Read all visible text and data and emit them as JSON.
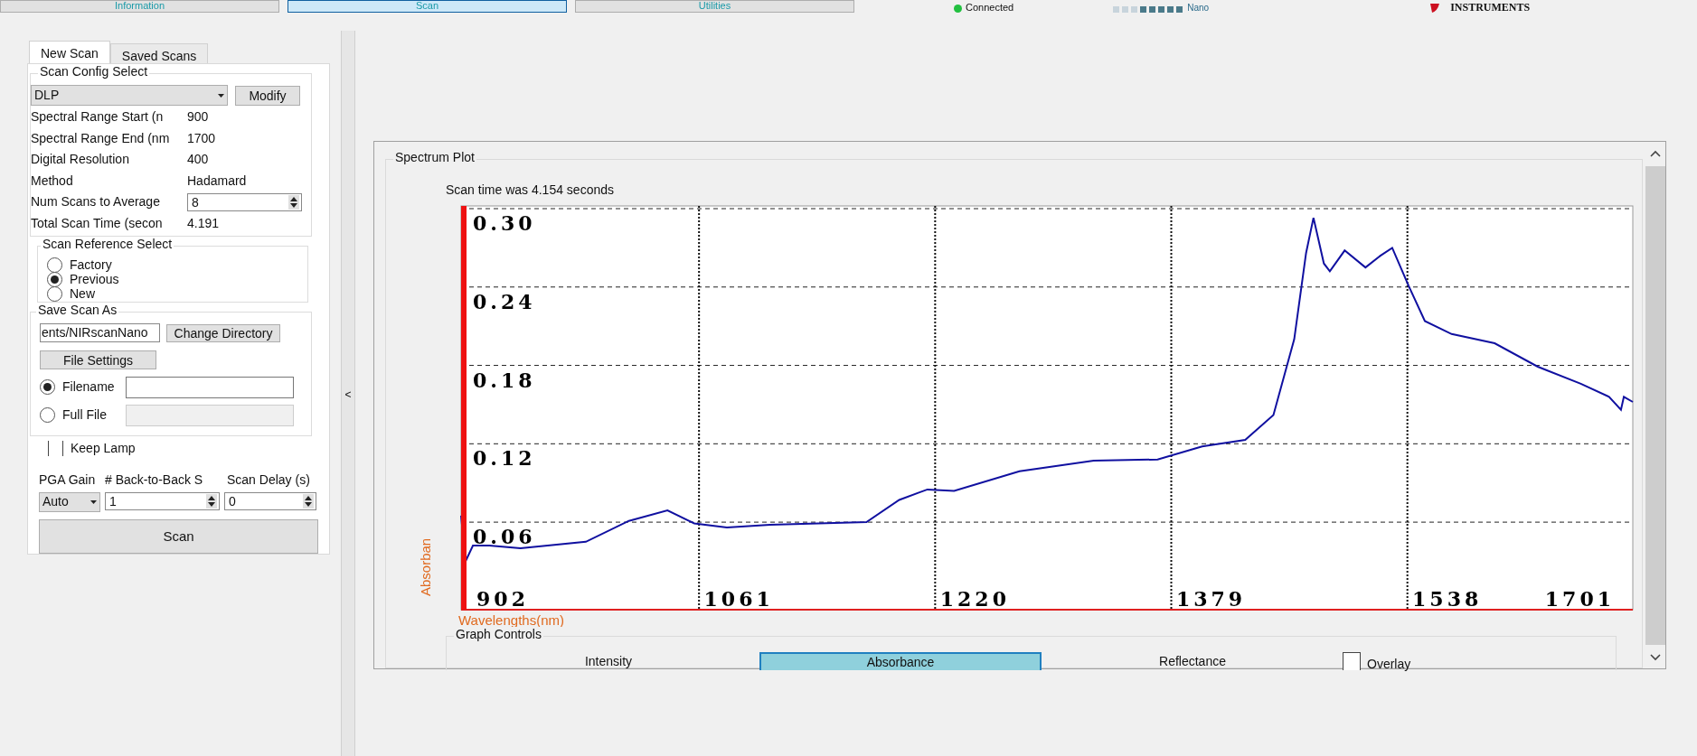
{
  "top_tabs": [
    {
      "label": "Information",
      "selected": false
    },
    {
      "label": "Scan",
      "selected": true
    },
    {
      "label": "Utilities",
      "selected": false
    }
  ],
  "status": {
    "label": "Connected",
    "connected": true
  },
  "logos": {
    "product": "Nano",
    "company": "INSTRUMENTS"
  },
  "left_tabs": [
    {
      "label": "New Scan",
      "selected": true
    },
    {
      "label": "Saved Scans",
      "selected": false
    }
  ],
  "scan_config": {
    "title": "Scan Config Select",
    "config": "DLP",
    "modify": "Modify",
    "fields": [
      {
        "kind": "text",
        "label": "Spectral Range Start (n",
        "value": "900"
      },
      {
        "kind": "text",
        "label": "Spectral Range End (nm",
        "value": "1700"
      },
      {
        "kind": "text",
        "label": "Digital Resolution",
        "value": "400"
      },
      {
        "kind": "text",
        "label": "Method",
        "value": "Hadamard"
      },
      {
        "kind": "spin",
        "label": "Num Scans to Average",
        "value": "8"
      },
      {
        "kind": "text",
        "label": "Total Scan Time (secon",
        "value": "4.191"
      }
    ]
  },
  "reference": {
    "title": "Scan Reference Select",
    "options": [
      {
        "label": "Factory",
        "selected": false
      },
      {
        "label": "Previous",
        "selected": true
      },
      {
        "label": "New",
        "selected": false
      }
    ]
  },
  "save": {
    "title": "Save Scan As",
    "directory": "ents/NIRscanNano",
    "change_directory": "Change Directory",
    "file_settings": "File Settings",
    "options": [
      {
        "label": "Filename",
        "selected": true,
        "enabled": true
      },
      {
        "label": "Full File",
        "selected": false,
        "enabled": false
      }
    ]
  },
  "keep_lamp": {
    "label": "Keep Lamp",
    "checked": false
  },
  "gain": {
    "label": "PGA Gain",
    "value": "Auto"
  },
  "back_to_back": {
    "label": "# Back-to-Back S",
    "value": "1"
  },
  "delay": {
    "label": "Scan Delay (s)",
    "value": "0"
  },
  "scan_button": "Scan",
  "splitter": "<",
  "spectrum": {
    "title": "Spectrum Plot",
    "scan_time": "Scan time was 4.154 seconds",
    "chart_data": {
      "type": "line",
      "xlabel": "Wavelengths(nm)",
      "ylabel": "Absorban",
      "grid": true,
      "xlim": [
        874,
        1663
      ],
      "ylim": [
        -0.007,
        0.3
      ],
      "xticks": [
        902,
        1061,
        1220,
        1379,
        1538
      ],
      "yticks": [
        {
          "value": 0.06,
          "label": "0.06"
        },
        {
          "value": 0.12,
          "label": "0.12"
        },
        {
          "value": 0.18,
          "label": "0.18"
        },
        {
          "value": 0.24,
          "label": "0.24"
        },
        {
          "value": 0.3,
          "label": "0.30"
        }
      ],
      "x": [
        874,
        877,
        882,
        893,
        914,
        958,
        987,
        1013,
        1031,
        1053,
        1082,
        1147,
        1169,
        1188,
        1206,
        1250,
        1300,
        1343,
        1373,
        1402,
        1421,
        1435,
        1443,
        1448,
        1455,
        1459,
        1469,
        1483,
        1493,
        1501,
        1512,
        1523,
        1541,
        1570,
        1599,
        1628,
        1647,
        1655,
        1657,
        1663
      ],
      "series": [
        {
          "color": "#1010a0",
          "values": [
            0.065,
            0.03,
            0.042,
            0.042,
            0.04,
            0.045,
            0.061,
            0.069,
            0.059,
            0.056,
            0.058,
            0.06,
            0.077,
            0.085,
            0.084,
            0.099,
            0.107,
            0.108,
            0.118,
            0.123,
            0.142,
            0.2,
            0.266,
            0.293,
            0.258,
            0.252,
            0.268,
            0.255,
            0.264,
            0.27,
            0.241,
            0.214,
            0.204,
            0.197,
            0.179,
            0.166,
            0.156,
            0.146,
            0.156,
            0.152
          ]
        }
      ]
    },
    "axis_end_label": "1701",
    "controls_title": "Graph Controls",
    "modes": [
      {
        "label": "Intensity",
        "selected": false
      },
      {
        "label": "Absorbance",
        "selected": true
      },
      {
        "label": "Reflectance",
        "selected": false
      }
    ],
    "overlay": {
      "label": "Overlay",
      "checked": false
    }
  }
}
